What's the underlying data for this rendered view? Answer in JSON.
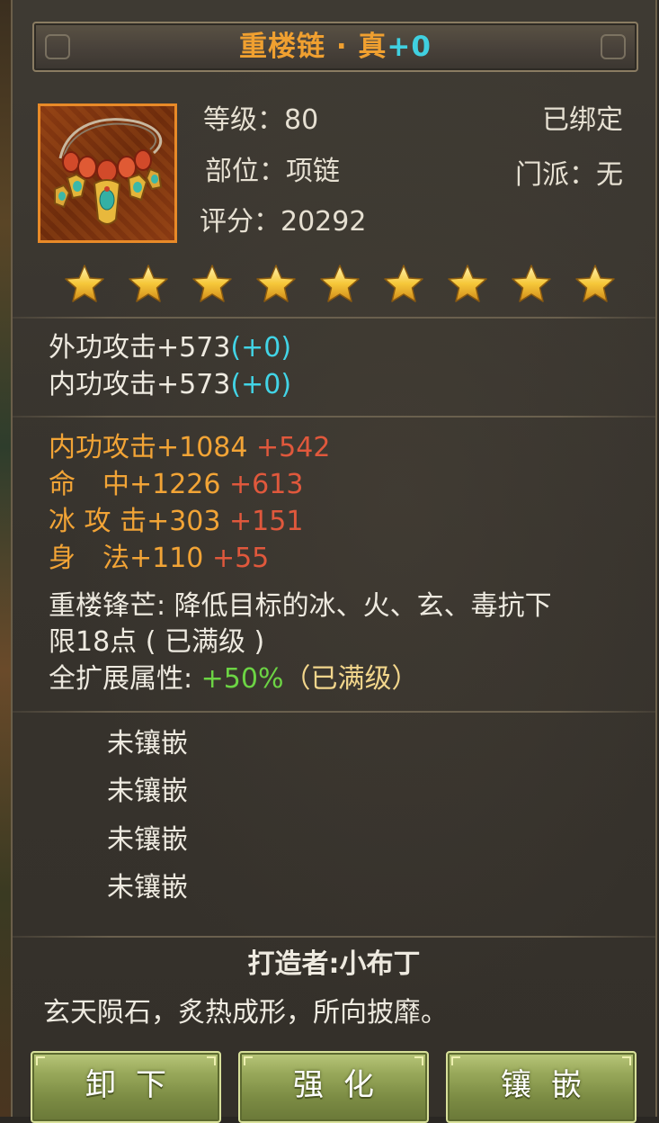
{
  "item": {
    "name": "重楼链 · 真",
    "enhance": "+0",
    "bound": "已绑定",
    "level_label": "等级：",
    "level": "80",
    "slot_label": "部位：",
    "slot": "项链",
    "sect_label": "门派：",
    "sect": "无",
    "score_label": "评分：",
    "score": "20292",
    "stars": 9,
    "icon": "necklace-icon"
  },
  "base_stats": [
    {
      "text": "外功攻击+573",
      "bonus": "(+0)"
    },
    {
      "text": "内功攻击+573",
      "bonus": "(+0)"
    }
  ],
  "extra_stats": [
    {
      "text": "内功攻击+1084",
      "bonus": "+542"
    },
    {
      "text": "命　中+1226",
      "bonus": "+613"
    },
    {
      "text": "冰 攻 击+303",
      "bonus": "+151"
    },
    {
      "text": "身　法+110",
      "bonus": "+55"
    }
  ],
  "special": {
    "line1": "重楼锋芒: 降低目标的冰、火、玄、毒抗下",
    "line2": "限18点 ( 已满级 )",
    "expand_label": "全扩展属性:",
    "expand_value": "+50%",
    "expand_status": "（已满级）"
  },
  "sockets": [
    "未镶嵌",
    "未镶嵌",
    "未镶嵌",
    "未镶嵌"
  ],
  "maker": "打造者:小布丁",
  "description": "玄天陨石，炙热成形，所向披靡。",
  "buttons": {
    "unequip": "卸下",
    "enhance": "强化",
    "inlay": "镶嵌"
  },
  "colors": {
    "title": "#f0a030",
    "cyan": "#42d4e6",
    "orange": "#f2a436",
    "red": "#e0583c",
    "green": "#6cd444",
    "frame": "#e88a28"
  }
}
